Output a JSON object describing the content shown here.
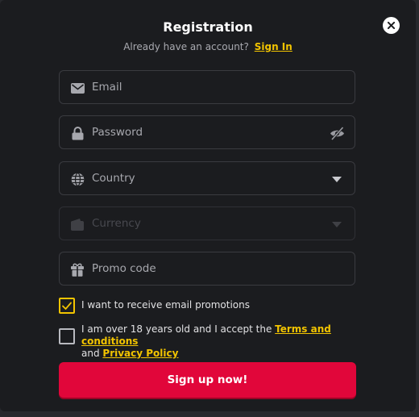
{
  "modal": {
    "title": "Registration",
    "signin_prompt": "Already have an account?",
    "signin_link": "Sign In"
  },
  "fields": {
    "email": {
      "placeholder": "Email",
      "value": "",
      "icon": "envelope-icon"
    },
    "password": {
      "placeholder": "Password",
      "value": "",
      "icon": "lock-icon",
      "toggle_icon": "eye-off-icon"
    },
    "country": {
      "placeholder": "Country",
      "value": "",
      "icon": "globe-icon"
    },
    "currency": {
      "placeholder": "Currency",
      "value": "",
      "icon": "wallet-icon",
      "disabled": true
    },
    "promo": {
      "placeholder": "Promo code",
      "value": "",
      "icon": "gift-icon"
    }
  },
  "consents": {
    "promotions": {
      "label": "I want to receive email promotions",
      "checked": true
    },
    "terms": {
      "checked": false,
      "text_before": "I am over 18 years old and I accept the",
      "terms_link": "Terms and conditions",
      "and_text": "and",
      "privacy_link": "Privacy Policy"
    }
  },
  "submit_label": "Sign up now!",
  "colors": {
    "accent": "#f2c400",
    "primary_button": "#e1063a",
    "background": "#1b1c1f"
  }
}
